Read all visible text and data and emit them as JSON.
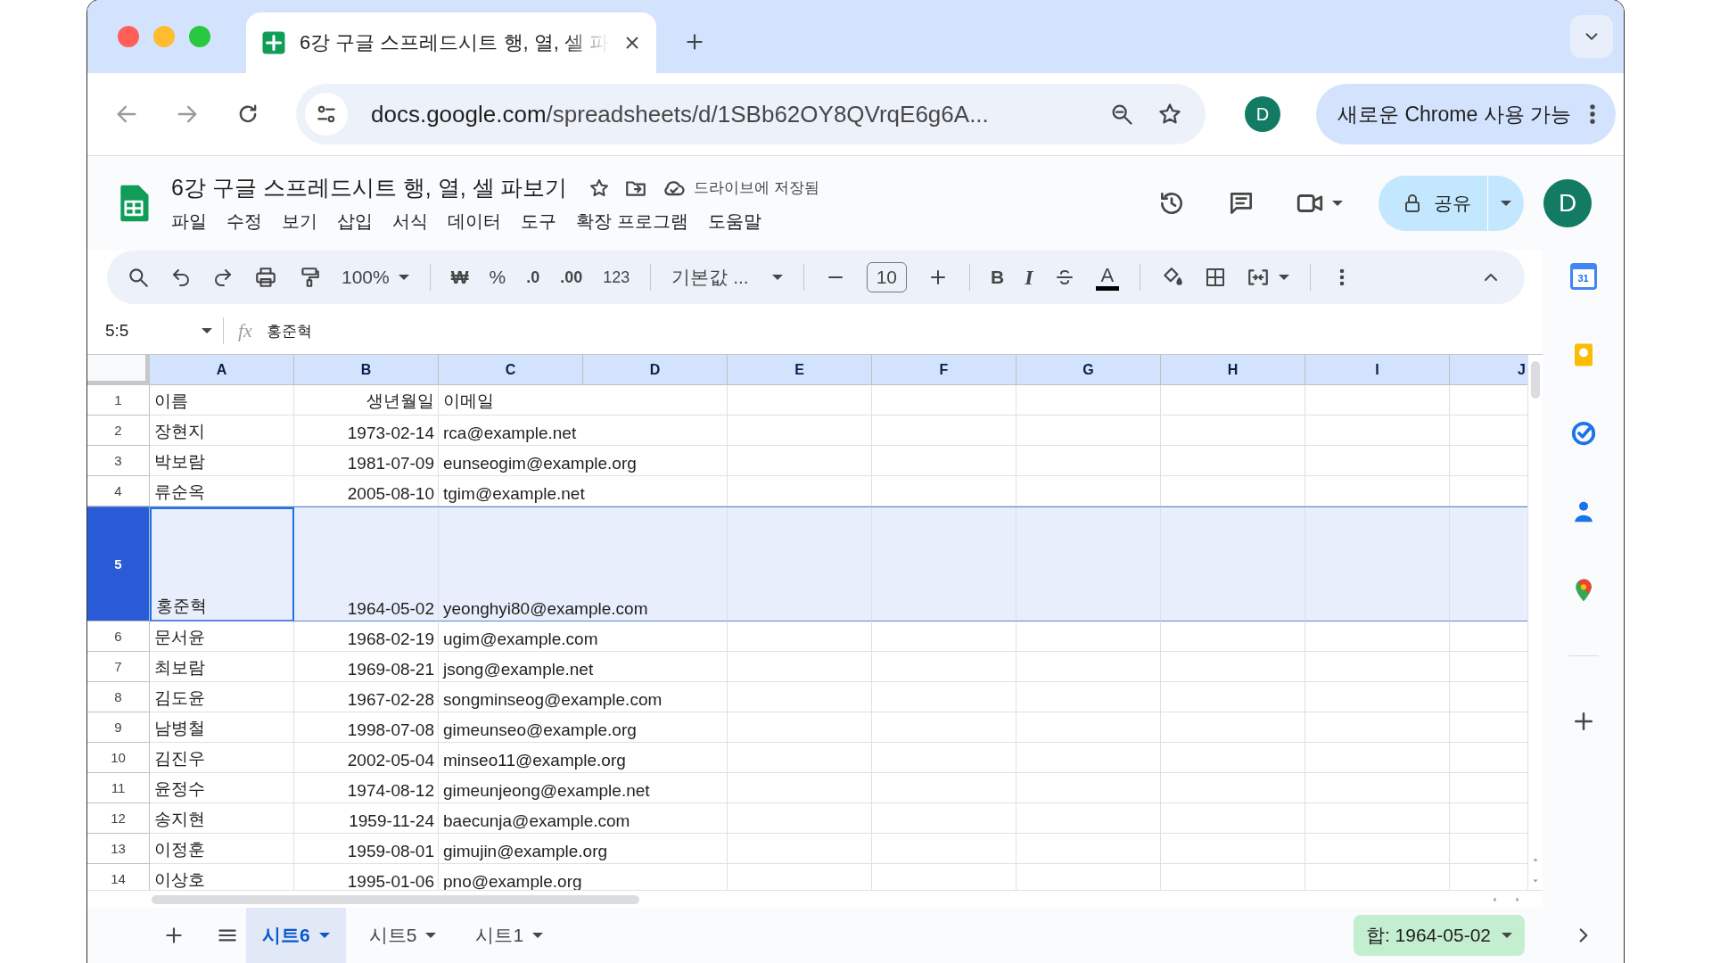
{
  "browser": {
    "tab": {
      "title": "6강 구글 스프레드시트 행, 열, 셀 파"
    },
    "url": {
      "host": "docs.google.com",
      "path": "/spreadsheets/d/1SBb62OY8QVrqE6g6A..."
    },
    "profile": "D",
    "update_button": "새로운 Chrome 사용 가능"
  },
  "document": {
    "title": "6강 구글 스프레드시트 행, 열, 셀 파보기",
    "save_status": "드라이브에 저장됨",
    "menus": [
      "파일",
      "수정",
      "보기",
      "삽입",
      "서식",
      "데이터",
      "도구",
      "확장 프로그램",
      "도움말"
    ],
    "share": "공유",
    "avatar": "D"
  },
  "toolbar": {
    "zoom": "100%",
    "currency": "₩",
    "percent": "%",
    "decrease_decimal": ".0",
    "increase_decimal": ".00",
    "number_format": "123",
    "font": "기본값 ...",
    "font_size": "10",
    "bold": "B",
    "italic": "I",
    "text_color": "A"
  },
  "formula_bar": {
    "name_box": "5:5",
    "fx": "fx",
    "value": "홍준혁"
  },
  "sheet": {
    "columns": [
      "A",
      "B",
      "C",
      "D",
      "E",
      "F",
      "G",
      "H",
      "I",
      "J"
    ],
    "rows": [
      {
        "number": "1",
        "selected": false,
        "tall": false,
        "cells": [
          {
            "text": "이름",
            "active": false
          },
          {
            "text": "생년월일",
            "active": false
          },
          {
            "text": "이메일",
            "active": false
          }
        ]
      },
      {
        "number": "2",
        "selected": false,
        "tall": false,
        "cells": [
          {
            "text": "장현지",
            "active": false
          },
          {
            "text": "1973-02-14",
            "active": false
          },
          {
            "text": "rca@example.net",
            "active": false
          }
        ]
      },
      {
        "number": "3",
        "selected": false,
        "tall": false,
        "cells": [
          {
            "text": "박보람",
            "active": false
          },
          {
            "text": "1981-07-09",
            "active": false
          },
          {
            "text": "eunseogim@example.org",
            "active": false
          }
        ]
      },
      {
        "number": "4",
        "selected": false,
        "tall": false,
        "cells": [
          {
            "text": "류순옥",
            "active": false
          },
          {
            "text": "2005-08-10",
            "active": false
          },
          {
            "text": "tgim@example.net",
            "active": false
          }
        ]
      },
      {
        "number": "5",
        "selected": true,
        "tall": true,
        "cells": [
          {
            "text": "홍준혁",
            "active": true
          },
          {
            "text": "1964-05-02",
            "active": false
          },
          {
            "text": "yeonghyi80@example.com",
            "active": false
          }
        ]
      },
      {
        "number": "6",
        "selected": false,
        "tall": false,
        "cells": [
          {
            "text": "문서윤",
            "active": false
          },
          {
            "text": "1968-02-19",
            "active": false
          },
          {
            "text": "ugim@example.com",
            "active": false
          }
        ]
      },
      {
        "number": "7",
        "selected": false,
        "tall": false,
        "cells": [
          {
            "text": "최보람",
            "active": false
          },
          {
            "text": "1969-08-21",
            "active": false
          },
          {
            "text": "jsong@example.net",
            "active": false
          }
        ]
      },
      {
        "number": "8",
        "selected": false,
        "tall": false,
        "cells": [
          {
            "text": "김도윤",
            "active": false
          },
          {
            "text": "1967-02-28",
            "active": false
          },
          {
            "text": "songminseog@example.com",
            "active": false
          }
        ]
      },
      {
        "number": "9",
        "selected": false,
        "tall": false,
        "cells": [
          {
            "text": "남병철",
            "active": false
          },
          {
            "text": "1998-07-08",
            "active": false
          },
          {
            "text": "gimeunseo@example.org",
            "active": false
          }
        ]
      },
      {
        "number": "10",
        "selected": false,
        "tall": false,
        "cells": [
          {
            "text": "김진우",
            "active": false
          },
          {
            "text": "2002-05-04",
            "active": false
          },
          {
            "text": "minseo11@example.org",
            "active": false
          }
        ]
      },
      {
        "number": "11",
        "selected": false,
        "tall": false,
        "cells": [
          {
            "text": "윤정수",
            "active": false
          },
          {
            "text": "1974-08-12",
            "active": false
          },
          {
            "text": "gimeunjeong@example.net",
            "active": false
          }
        ]
      },
      {
        "number": "12",
        "selected": false,
        "tall": false,
        "cells": [
          {
            "text": "송지현",
            "active": false
          },
          {
            "text": "1959-11-24",
            "active": false
          },
          {
            "text": "baecunja@example.com",
            "active": false
          }
        ]
      },
      {
        "number": "13",
        "selected": false,
        "tall": false,
        "cells": [
          {
            "text": "이정훈",
            "active": false
          },
          {
            "text": "1959-08-01",
            "active": false
          },
          {
            "text": "gimujin@example.org",
            "active": false
          }
        ]
      },
      {
        "number": "14",
        "selected": false,
        "tall": false,
        "cells": [
          {
            "text": "이상호",
            "active": false
          },
          {
            "text": "1995-01-06",
            "active": false
          },
          {
            "text": "pno@example.org",
            "active": false
          }
        ]
      }
    ]
  },
  "sheet_tabs": [
    {
      "label": "시트6",
      "selected": true
    },
    {
      "label": "시트5",
      "selected": false
    },
    {
      "label": "시트1",
      "selected": false
    }
  ],
  "summary": "합: 1964-05-02",
  "side_panel": {
    "calendar_day": "31"
  }
}
